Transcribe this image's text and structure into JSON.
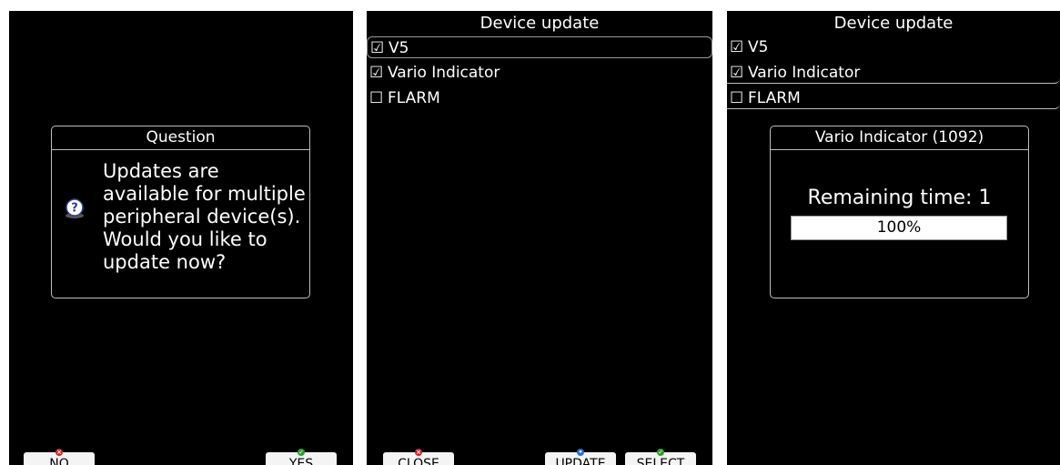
{
  "screen1": {
    "dialog_title": "Question",
    "message_lines": [
      "Updates are",
      "available for multiple",
      "peripheral device(s).",
      "Would you like to",
      "update now?"
    ],
    "icon": "question-icon",
    "buttons": {
      "no": "NO",
      "yes": "YES"
    }
  },
  "screen2": {
    "title": "Device update",
    "devices": [
      {
        "check": "☑",
        "label": "V5"
      },
      {
        "check": "☑",
        "label": "Vario Indicator"
      },
      {
        "check": "☐",
        "label": "FLARM"
      }
    ],
    "buttons": {
      "close": "CLOSE",
      "update": "UPDATE",
      "select": "SELECT"
    }
  },
  "screen3": {
    "title": "Device update",
    "devices": [
      {
        "check": "☑",
        "label": "V5"
      },
      {
        "check": "☑",
        "label": "Vario Indicator"
      },
      {
        "check": "☐",
        "label": "FLARM"
      }
    ],
    "progress_dialog": {
      "title": "Vario Indicator (1092)",
      "remaining_label": "Remaining time:  1",
      "progress_text": "100%",
      "progress_value": 1.0
    }
  },
  "colors": {
    "screen_bg": "#000000",
    "text": "#ffffff",
    "softkey_bg": "#f4f4f4",
    "badge_red": "#d62020",
    "badge_green": "#26a526",
    "badge_blue": "#2c6fd8"
  }
}
